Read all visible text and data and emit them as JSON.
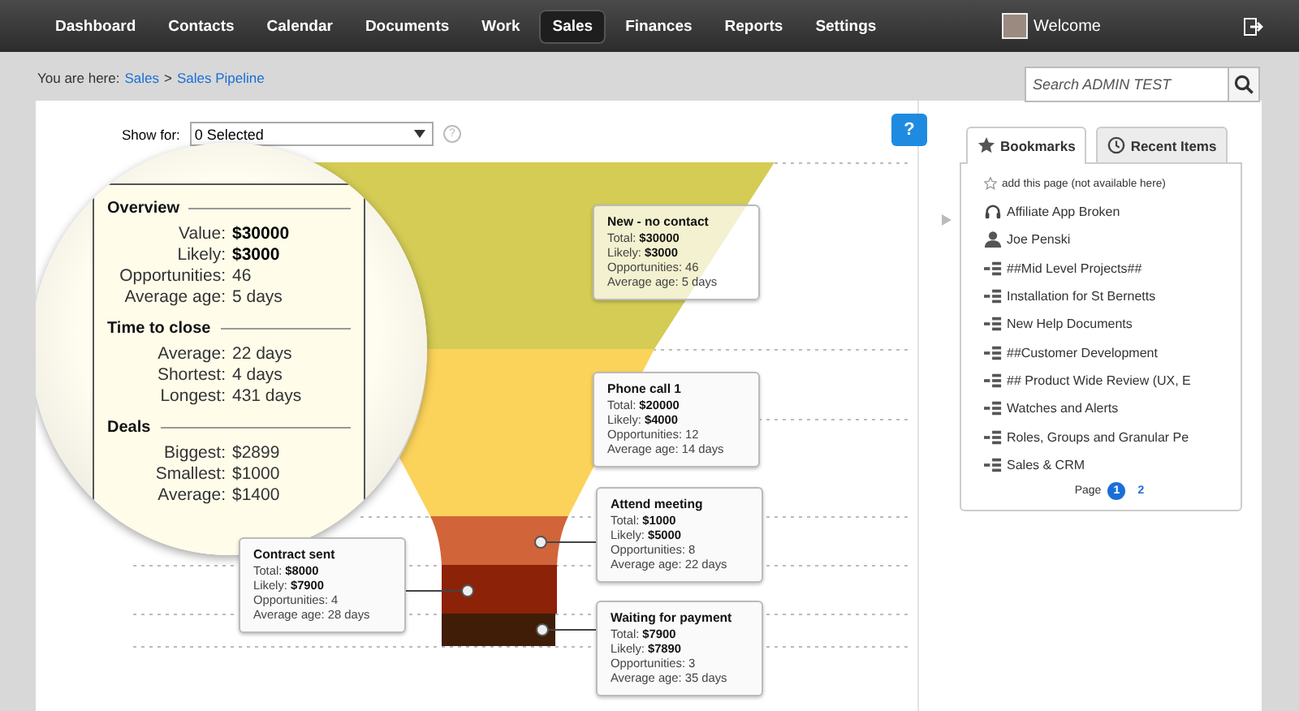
{
  "nav": {
    "items": [
      {
        "label": "Dashboard",
        "selected": false
      },
      {
        "label": "Contacts",
        "selected": false
      },
      {
        "label": "Calendar",
        "selected": false
      },
      {
        "label": "Documents",
        "selected": false
      },
      {
        "label": "Work",
        "selected": false
      },
      {
        "label": "Sales",
        "selected": true
      },
      {
        "label": "Finances",
        "selected": false
      },
      {
        "label": "Reports",
        "selected": false
      },
      {
        "label": "Settings",
        "selected": false
      }
    ],
    "welcome": "Welcome"
  },
  "breadcrumb": {
    "prefix": "You are here:",
    "links": [
      "Sales",
      "Sales Pipeline"
    ],
    "separator": ">"
  },
  "help_marker": "?",
  "search": {
    "placeholder": "Search ADMIN TEST"
  },
  "filter": {
    "label": "Show for:",
    "value": "0 Selected",
    "help": "?"
  },
  "summary": {
    "sections": [
      {
        "title": "Overview",
        "rows": [
          {
            "label": "Value:",
            "value": "$30000",
            "emphasis": true
          },
          {
            "label": "Likely:",
            "value": "$3000",
            "emphasis": true
          },
          {
            "label": "Opportunities:",
            "value": "46",
            "emphasis": false
          },
          {
            "label": "Average age:",
            "value": "5 days",
            "emphasis": false
          }
        ]
      },
      {
        "title": "Time to close",
        "rows": [
          {
            "label": "Average:",
            "value": "22 days",
            "emphasis": false
          },
          {
            "label": "Shortest:",
            "value": "4 days",
            "emphasis": false
          },
          {
            "label": "Longest:",
            "value": "431 days",
            "emphasis": false
          }
        ]
      },
      {
        "title": "Deals",
        "rows": [
          {
            "label": "Biggest:",
            "value": "$2899",
            "emphasis": false
          },
          {
            "label": "Smallest:",
            "value": "$1000",
            "emphasis": false
          },
          {
            "label": "Average:",
            "value": "$1400",
            "emphasis": false
          }
        ]
      }
    ]
  },
  "funnel": {
    "stages": [
      {
        "title": "New - no contact",
        "color": "#d4cc55",
        "lines": [
          {
            "label": "Total:",
            "value": "$30000",
            "emphasis": true
          },
          {
            "label": "Likely:",
            "value": "$3000",
            "emphasis": true
          },
          {
            "label": "Opportunities:",
            "value": "46",
            "emphasis": false
          },
          {
            "label": "Average age:",
            "value": "5 days",
            "emphasis": false
          }
        ]
      },
      {
        "title": "Phone call 1",
        "color": "#fbd35a",
        "lines": [
          {
            "label": "Total:",
            "value": "$20000",
            "emphasis": true
          },
          {
            "label": "Likely:",
            "value": "$4000",
            "emphasis": true
          },
          {
            "label": "Opportunities:",
            "value": "12",
            "emphasis": false
          },
          {
            "label": "Average age:",
            "value": "14 days",
            "emphasis": false
          }
        ]
      },
      {
        "title": "Attend meeting",
        "color": "#d2643a",
        "lines": [
          {
            "label": "Total:",
            "value": "$1000",
            "emphasis": true
          },
          {
            "label": "Likely:",
            "value": "$5000",
            "emphasis": true
          },
          {
            "label": "Opportunities:",
            "value": "8",
            "emphasis": false
          },
          {
            "label": "Average age:",
            "value": "22 days",
            "emphasis": false
          }
        ]
      },
      {
        "title": "Contract sent",
        "color": "#8c2208",
        "lines": [
          {
            "label": "Total:",
            "value": "$8000",
            "emphasis": true
          },
          {
            "label": "Likely:",
            "value": "$7900",
            "emphasis": true
          },
          {
            "label": "Opportunities:",
            "value": "4",
            "emphasis": false
          },
          {
            "label": "Average age:",
            "value": "28 days",
            "emphasis": false
          }
        ]
      },
      {
        "title": "Waiting for payment",
        "color": "#3f1d06",
        "lines": [
          {
            "label": "Total:",
            "value": "$7900",
            "emphasis": true
          },
          {
            "label": "Likely:",
            "value": "$7890",
            "emphasis": true
          },
          {
            "label": "Opportunities:",
            "value": "3",
            "emphasis": false
          },
          {
            "label": "Average age:",
            "value": "35 days",
            "emphasis": false
          }
        ]
      }
    ]
  },
  "sidebar": {
    "tabs": [
      {
        "label": "Bookmarks",
        "selected": true,
        "kind": "star"
      },
      {
        "label": "Recent Items",
        "selected": false,
        "kind": "clock"
      }
    ],
    "add_text": "add this page (not available here)",
    "items": [
      {
        "label": "Affiliate App Broken",
        "kind": "support"
      },
      {
        "label": "Joe Penski",
        "kind": "person"
      },
      {
        "label": "##Mid Level Projects##",
        "kind": "project"
      },
      {
        "label": "Installation for St Bernetts",
        "kind": "project"
      },
      {
        "label": "New Help Documents",
        "kind": "project"
      },
      {
        "label": "##Customer Development",
        "kind": "project"
      },
      {
        "label": "## Product Wide Review (UX, E",
        "kind": "project"
      },
      {
        "label": "Watches and Alerts",
        "kind": "project"
      },
      {
        "label": "Roles, Groups and Granular Pe",
        "kind": "project"
      },
      {
        "label": "Sales & CRM",
        "kind": "project"
      }
    ],
    "pagination": {
      "label": "Page",
      "pages": [
        {
          "label": "1",
          "selected": true
        },
        {
          "label": "2",
          "selected": false
        }
      ]
    }
  }
}
